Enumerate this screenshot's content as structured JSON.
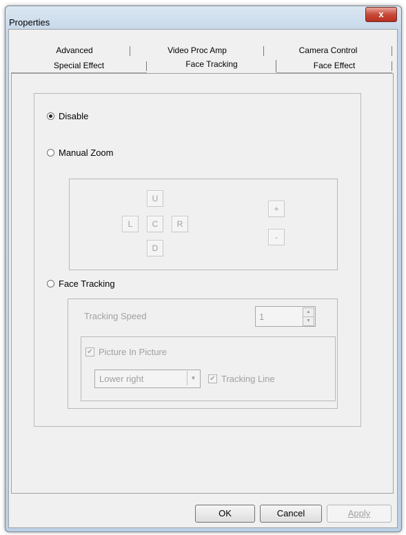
{
  "window": {
    "title": "Properties",
    "close_label": "x"
  },
  "tabs": {
    "row1": [
      "Advanced",
      "Video Proc Amp",
      "Camera Control"
    ],
    "row2": [
      "Special Effect",
      "Face Tracking",
      "Face Effect"
    ],
    "active": "Face Tracking"
  },
  "options": {
    "disable": "Disable",
    "manual_zoom": "Manual Zoom",
    "face_tracking": "Face Tracking",
    "selected": "Disable"
  },
  "zoom_pad": {
    "up": "U",
    "left": "L",
    "center": "C",
    "right": "R",
    "down": "D",
    "plus": "+",
    "minus": "-"
  },
  "tracking": {
    "speed_label": "Tracking Speed",
    "speed_value": "1",
    "pip_label": "Picture In Picture",
    "pip_checked": true,
    "position_value": "Lower right",
    "tracking_line_label": "Tracking Line",
    "tracking_line_checked": true
  },
  "buttons": {
    "ok": "OK",
    "cancel": "Cancel",
    "apply": "Apply"
  }
}
